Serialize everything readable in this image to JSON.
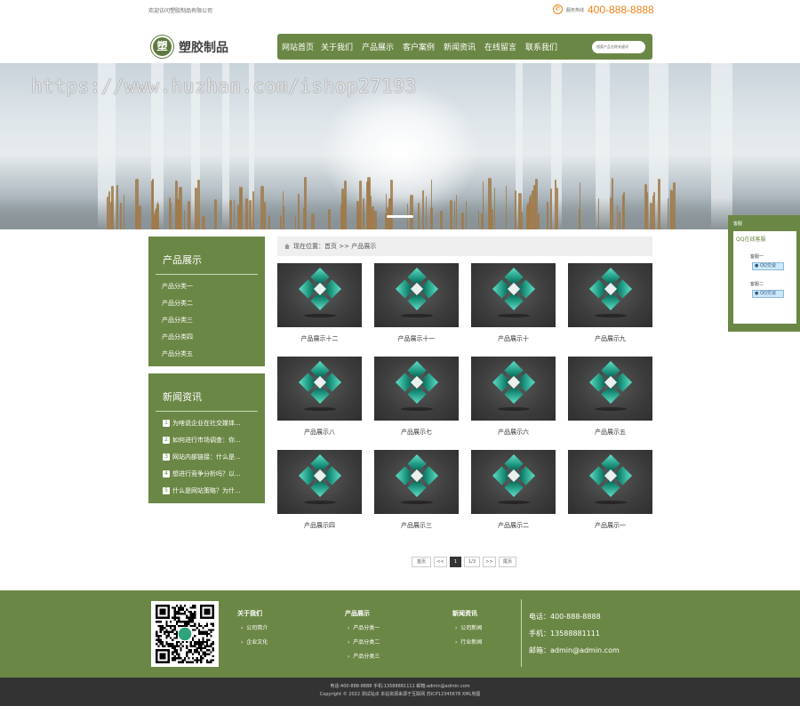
{
  "topbar": {
    "welcome": "欢迎访问塑胶制品有限公司",
    "hotline_label": "服务热线",
    "hotline": "400-888-8888"
  },
  "logo": {
    "mark": "塑",
    "name": "塑胶制品"
  },
  "nav": {
    "items": [
      "网站首页",
      "关于我们",
      "产品展示",
      "客户案例",
      "新闻资讯",
      "在线留言",
      "联系我们"
    ],
    "search_placeholder": "搜索产品名称关键词"
  },
  "banner": {
    "watermark": "https://www.huzhan.com/ishop27193"
  },
  "sidebar": {
    "products_title": "产品展示",
    "categories": [
      "产品分类一",
      "产品分类二",
      "产品分类三",
      "产品分类四",
      "产品分类五"
    ],
    "news_title": "新闻资讯",
    "news": [
      {
        "num": "1",
        "text": "为啥说企业在社交媒体..."
      },
      {
        "num": "2",
        "text": "如何进行市场调查：你..."
      },
      {
        "num": "3",
        "text": "网站内部链接：什么是..."
      },
      {
        "num": "4",
        "text": "想进行竞争分析吗？以..."
      },
      {
        "num": "5",
        "text": "什么是网站策略？为什..."
      }
    ]
  },
  "breadcrumb": {
    "prefix": "现在位置：",
    "home": "首页",
    "sep": ">>",
    "current": "产品展示"
  },
  "products": [
    "产品展示十二",
    "产品展示十一",
    "产品展示十",
    "产品展示九",
    "产品展示八",
    "产品展示七",
    "产品展示六",
    "产品展示五",
    "产品展示四",
    "产品展示三",
    "产品展示二",
    "产品展示一"
  ],
  "pagination": {
    "first": "首页",
    "prev": "<<",
    "current": "1",
    "info": "1/3",
    "next": ">>",
    "last": "尾页"
  },
  "footer": {
    "col1_title": "关于我们",
    "col1_links": [
      "公司简介",
      "企业文化"
    ],
    "col2_title": "产品展示",
    "col2_links": [
      "产品分类一",
      "产品分类二",
      "产品分类三"
    ],
    "col3_title": "新闻资讯",
    "col3_links": [
      "公司新闻",
      "行业新闻"
    ],
    "phone": "电话：400-888-8888",
    "mobile": "手机：13588881111",
    "email": "邮箱：admin@admin.com"
  },
  "bottom": {
    "line1": "电话:400-888-8888  手机:13588881111  邮箱:admin@admin.com",
    "line2": "Copyright © 2022 测试站点 本站资源来源于互联网  苏ICP12345678  XML地图"
  },
  "float_service": {
    "head": "客服",
    "title": "QQ在线客服",
    "svc1": "客服一",
    "svc2": "客服二",
    "qq_label": "QQ交谈"
  },
  "colors": {
    "brand": "#6b8745",
    "hotline": "#e8831a",
    "footer_bottom": "#333333"
  }
}
